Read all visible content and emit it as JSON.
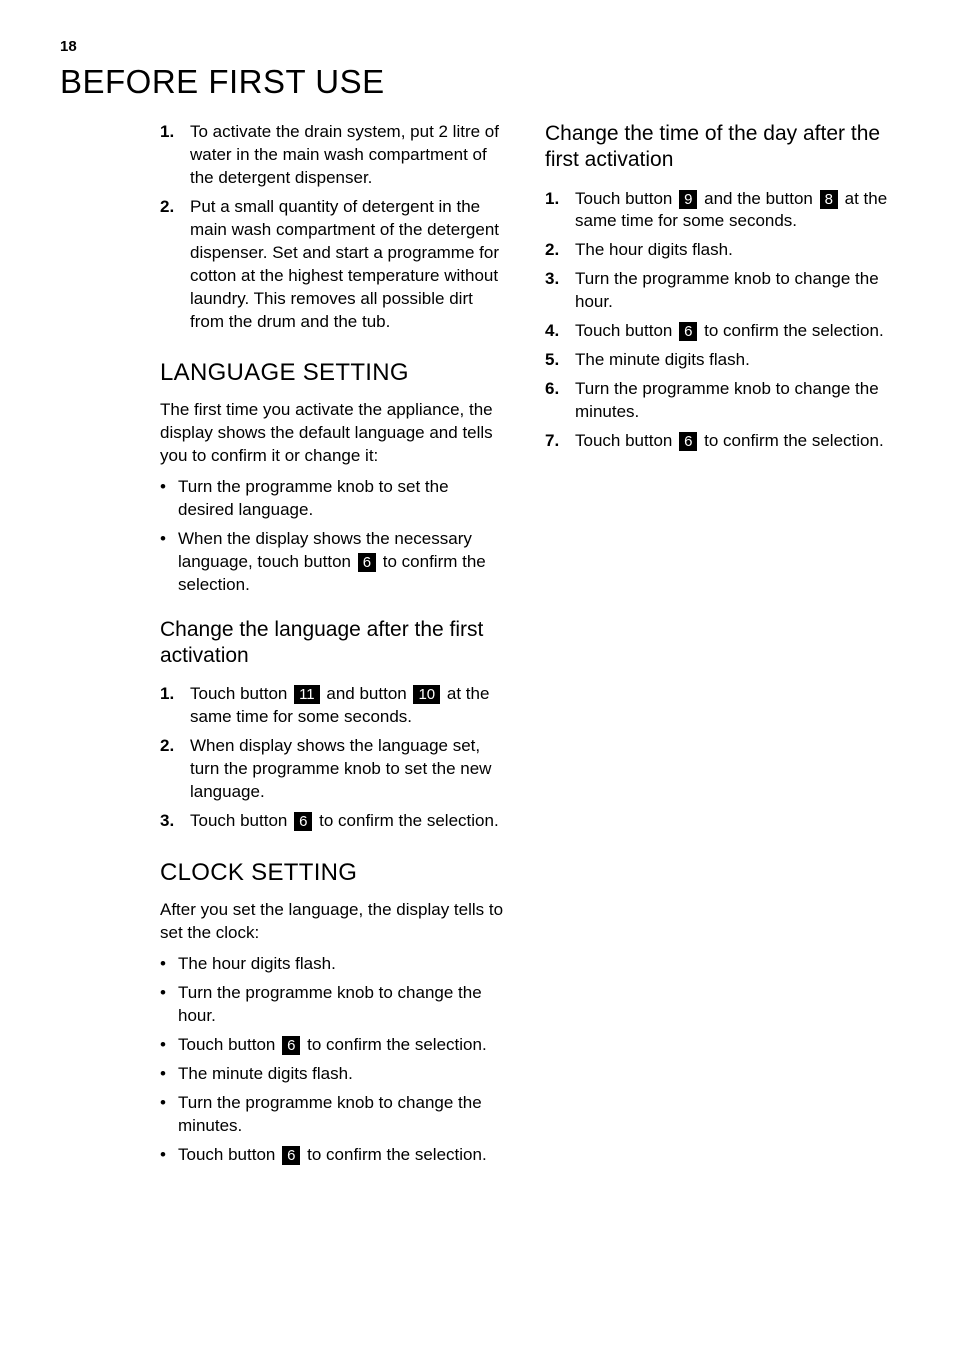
{
  "page_number": "18",
  "main_title": "BEFORE FIRST USE",
  "col_left": {
    "initial_steps": [
      "To activate the drain system, put 2 litre of water in the main wash compartment of the detergent dispenser.",
      "Put a small quantity of detergent in the main wash compartment of the detergent dispenser. Set and start a programme for cotton at the highest temperature without laundry. This removes all possible dirt from the drum and the tub."
    ],
    "language_setting": {
      "title": "LANGUAGE SETTING",
      "intro": "The first time you activate the appliance, the display shows the default language and tells you to confirm it or change it:",
      "bullets": [
        "Turn the programme knob to set the desired language.",
        {
          "pre": "When the display shows the necessary language, touch button ",
          "btn": "6",
          "post": " to confirm the selection."
        }
      ]
    },
    "change_language": {
      "title": "Change the language after the first activation",
      "steps": [
        {
          "pre": "Touch button ",
          "btn1": "11",
          "mid": " and button ",
          "btn2": "10",
          "post": " at the same time for some seconds."
        },
        "When display shows the language set, turn the programme knob to set the new language.",
        {
          "pre": "Touch button ",
          "btn": "6",
          "post": " to confirm the selection."
        }
      ]
    },
    "clock_setting": {
      "title": "CLOCK SETTING",
      "intro": "After you set the language, the display tells to set the clock:",
      "bullets": [
        "The hour digits flash.",
        "Turn the programme knob to change the hour.",
        {
          "pre": "Touch button ",
          "btn": "6",
          "post": " to confirm the selection."
        },
        "The minute digits flash.",
        "Turn the programme knob to change the minutes.",
        {
          "pre": "Touch button ",
          "btn": "6",
          "post": " to confirm the selection."
        }
      ]
    }
  },
  "col_right": {
    "change_time": {
      "title": "Change the time of the day after the first activation",
      "steps": [
        {
          "pre": "Touch button ",
          "btn1": "9",
          "mid": " and the button ",
          "btn2": "8",
          "post": " at the same time for some seconds."
        },
        "The hour digits flash.",
        "Turn the programme knob to change the hour.",
        {
          "pre": "Touch button ",
          "btn": "6",
          "post": " to confirm the selection."
        },
        "The minute digits flash.",
        "Turn the programme knob to change the minutes.",
        {
          "pre": "Touch button ",
          "btn": "6",
          "post": " to confirm the selection."
        }
      ]
    }
  }
}
